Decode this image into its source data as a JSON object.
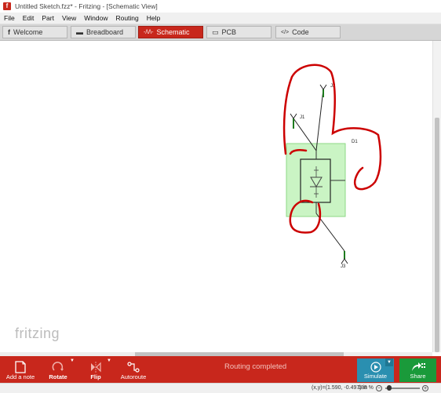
{
  "window": {
    "title": "Untitled Sketch.fzz* - Fritzing - [Schematic View]",
    "app_icon": "f"
  },
  "menu": [
    "File",
    "Edit",
    "Part",
    "View",
    "Window",
    "Routing",
    "Help"
  ],
  "tabs": [
    {
      "label": "Welcome",
      "icon": "f",
      "active": false
    },
    {
      "label": "Breadboard",
      "icon": "▬",
      "active": false
    },
    {
      "label": "Schematic",
      "icon": "-/\\/\\-",
      "active": true
    },
    {
      "label": "PCB",
      "icon": "▭",
      "active": false
    },
    {
      "label": "Code",
      "icon": "</>",
      "active": false
    }
  ],
  "canvas": {
    "parts": {
      "j1": "J1",
      "j2": "J2",
      "j3": "J3",
      "d1": "D1"
    },
    "watermark": "fritzing"
  },
  "toolbar": {
    "add_note": "Add a note",
    "rotate": "Rotate",
    "flip": "Flip",
    "autoroute": "Autoroute",
    "routing_status": "Routing completed",
    "simulate": "Simulate",
    "share": "Share"
  },
  "statusbar": {
    "coords": "(x,y)=(1.590, -0.497) in",
    "zoom": "188 %",
    "zoom_level": 0.05
  },
  "colors": {
    "accent": "#c8271c",
    "simulate": "#2a8fb0",
    "share": "#1a9a3a",
    "selection": "#b8f0b0",
    "annotation": "#cc0000"
  }
}
